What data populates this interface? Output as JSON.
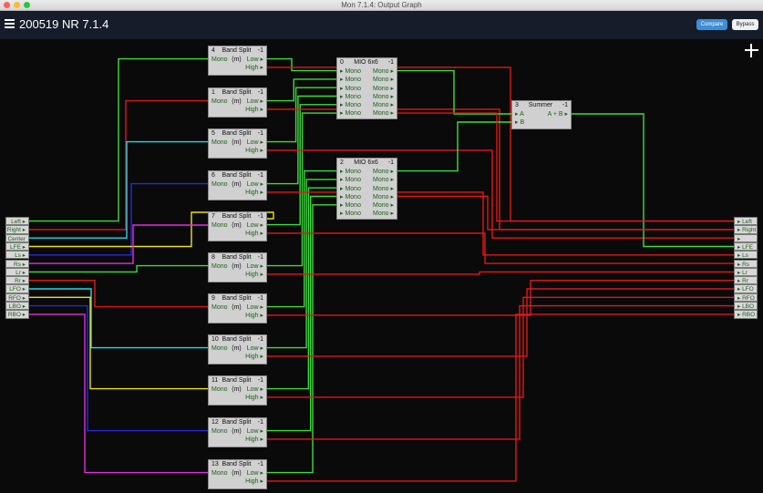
{
  "window": {
    "title": "Mon 7.1.4: Output Graph",
    "lights": [
      "#ff5f57",
      "#febc2e",
      "#28c840"
    ]
  },
  "app": {
    "title": "200519 NR 7.1.4",
    "compare": "Compare",
    "bypass": "Bypass"
  },
  "colors": {
    "green": "#3ddc3d",
    "red": "#e01818",
    "cyan": "#20d8e8",
    "blue": "#2828e0",
    "magenta": "#e030e0",
    "yellow": "#e8e020",
    "port_text": "#1d5e1d"
  },
  "inputs": [
    "Left",
    "Right",
    "Center",
    "LFE",
    "Ls",
    "Rs",
    "Lr",
    "Rr",
    "LFO",
    "RFO",
    "LBO",
    "RBO"
  ],
  "outputs": [
    "Left",
    "Right",
    "Center",
    "LFE",
    "Ls",
    "Rs",
    "Lr",
    "Rr",
    "LFO",
    "RFO",
    "LBO",
    "RBO"
  ],
  "band_splits": [
    {
      "id": "4",
      "name": "Band Split (m)",
      "ch": "-1",
      "in": "Mono",
      "out": [
        "Low",
        "High"
      ]
    },
    {
      "id": "1",
      "name": "Band Split (m)",
      "ch": "-1",
      "in": "Mono",
      "out": [
        "Low",
        "High"
      ]
    },
    {
      "id": "5",
      "name": "Band Split (m)",
      "ch": "-1",
      "in": "Mono",
      "out": [
        "Low",
        "High"
      ]
    },
    {
      "id": "6",
      "name": "Band Split (m)",
      "ch": "-1",
      "in": "Mono",
      "out": [
        "Low",
        "High"
      ]
    },
    {
      "id": "7",
      "name": "Band Split (m)",
      "ch": "-1",
      "in": "Mono",
      "out": [
        "Low",
        "High"
      ]
    },
    {
      "id": "8",
      "name": "Band Split (m)",
      "ch": "-1",
      "in": "Mono",
      "out": [
        "Low",
        "High"
      ]
    },
    {
      "id": "9",
      "name": "Band Split (m)",
      "ch": "-1",
      "in": "Mono",
      "out": [
        "Low",
        "High"
      ]
    },
    {
      "id": "10",
      "name": "Band Split (m)",
      "ch": "-1",
      "in": "Mono",
      "out": [
        "Low",
        "High"
      ]
    },
    {
      "id": "11",
      "name": "Band Split (m)",
      "ch": "-1",
      "in": "Mono",
      "out": [
        "Low",
        "High"
      ]
    },
    {
      "id": "12",
      "name": "Band Split (m)",
      "ch": "-1",
      "in": "Mono",
      "out": [
        "Low",
        "High"
      ]
    },
    {
      "id": "13",
      "name": "Band Split (m)",
      "ch": "-1",
      "in": "Mono",
      "out": [
        "Low",
        "High"
      ]
    }
  ],
  "mios": [
    {
      "id": "0",
      "name": "MIO 6x6",
      "ch": "-1",
      "rows": [
        [
          "Mono",
          "Mono"
        ],
        [
          "Mono",
          "Mono"
        ],
        [
          "Mono",
          "Mono"
        ],
        [
          "Mono",
          "Mono"
        ],
        [
          "Mono",
          "Mono"
        ],
        [
          "Mono",
          "Mono"
        ]
      ]
    },
    {
      "id": "2",
      "name": "MIO 6x6",
      "ch": "-1",
      "rows": [
        [
          "Mono",
          "Mono"
        ],
        [
          "Mono",
          "Mono"
        ],
        [
          "Mono",
          "Mono"
        ],
        [
          "Mono",
          "Mono"
        ],
        [
          "Mono",
          "Mono"
        ],
        [
          "Mono",
          "Mono"
        ]
      ]
    }
  ],
  "summer": {
    "id": "3",
    "name": "Summer",
    "ch": "-1",
    "rows": [
      [
        "A",
        "A + B"
      ],
      [
        "B",
        ""
      ]
    ]
  }
}
